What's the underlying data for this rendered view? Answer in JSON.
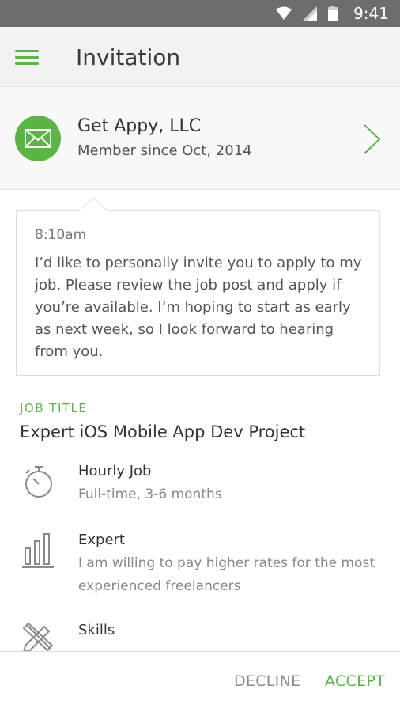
{
  "status_bar": {
    "time": "9:41",
    "icons": [
      "wifi-icon",
      "signal-icon",
      "battery-icon"
    ],
    "background": "#6d6d6d"
  },
  "app_bar": {
    "title": "Invitation",
    "menu_icon": "hamburger-menu-icon"
  },
  "client": {
    "name": "Get Appy, LLC",
    "member_since": "Member since Oct, 2014",
    "avatar_icon": "envelope-icon",
    "accent_color": "#5bb545"
  },
  "message": {
    "time": "8:10am",
    "text": "I’d like to personally invite you to apply to my job. Please review the job post and apply if you’re available. I’m hoping to start as early as next week, so I look forward to hearing from you."
  },
  "job": {
    "section_label": "JOB TITLE",
    "title": "Expert iOS Mobile App Dev Project",
    "details": [
      {
        "icon": "stopwatch-icon",
        "title": "Hourly Job",
        "subtitle": "Full-time, 3-6 months"
      },
      {
        "icon": "bar-chart-icon",
        "title": "Expert",
        "subtitle": "I am willing to pay higher rates for the most experienced freelancers"
      },
      {
        "icon": "pencil-ruler-icon",
        "title": "Skills",
        "subtitle": ""
      }
    ]
  },
  "actions": {
    "decline": "DECLINE",
    "accept": "ACCEPT"
  }
}
